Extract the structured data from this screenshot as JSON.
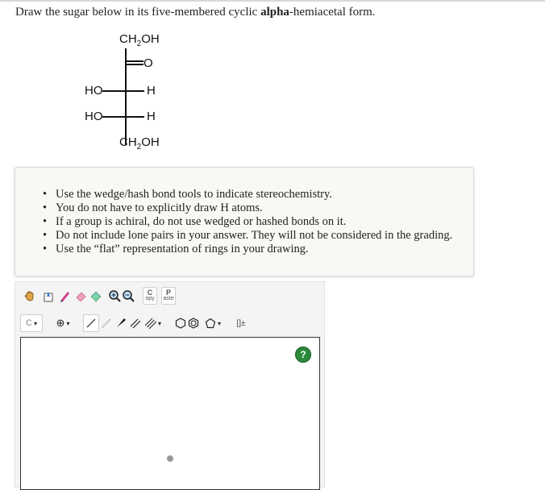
{
  "question": {
    "prefix": "Draw the sugar below in its five-membered cyclic ",
    "bold": "alpha",
    "suffix": "-hemiacetal form."
  },
  "fischer": {
    "top_group_main": "CH",
    "top_group_sub": "2",
    "top_group_end": "OH",
    "carbonyl": "O",
    "row1_left": "HO",
    "row1_right": "H",
    "row2_left": "HO",
    "row2_right": "H",
    "bottom_group_main": "CH",
    "bottom_group_sub": "2",
    "bottom_group_end": "OH"
  },
  "hints": [
    "Use the wedge/hash bond tools to indicate stereochemistry.",
    "You do not have to explicitly draw H atoms.",
    "If a group is achiral, do not use wedged or hashed bonds on it.",
    "Do not include lone pairs in your answer. They will not be considered in the grading.",
    "Use the “flat” representation of rings in your drawing."
  ],
  "toolbar": {
    "copy_letter": "C",
    "copy_text": "opy",
    "paste_letter": "P",
    "paste_text": "aste",
    "carbon_label": "C",
    "plus_symbol": "⊕",
    "caret": "▾",
    "bracket_label": "[]±"
  },
  "help": {
    "label": "?"
  }
}
